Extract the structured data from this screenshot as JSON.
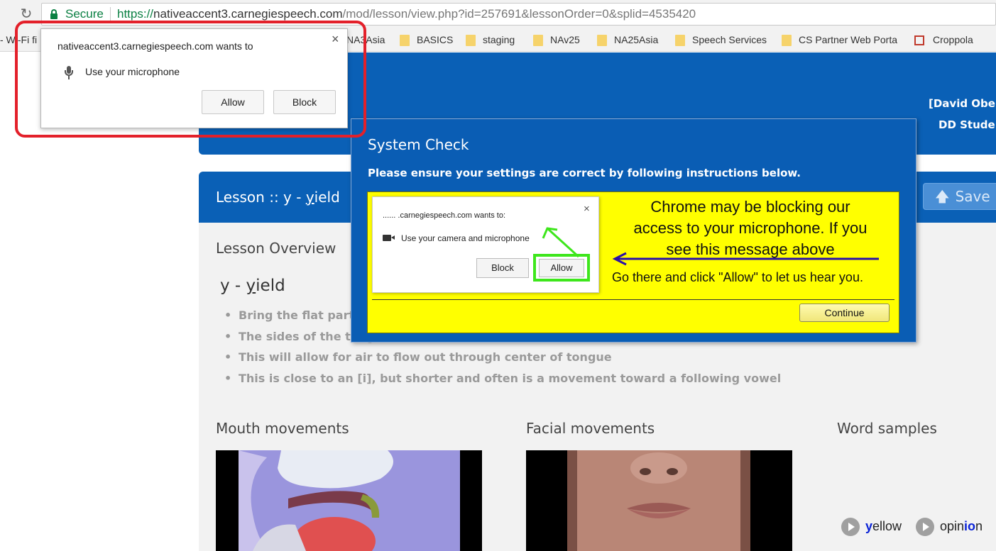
{
  "browser": {
    "secure_label": "Secure",
    "url_proto": "https://",
    "url_host": "nativeaccent3.carnegiespeech.com",
    "url_path": "/mod/lesson/view.php?id=257691&lessonOrder=0&splid=4535420",
    "bookmarks": [
      {
        "label": "- Wi-Fi fi",
        "icon": "none"
      },
      {
        "label": "NA3Asia",
        "icon": "none"
      },
      {
        "label": "BASICS",
        "icon": "folder-icon"
      },
      {
        "label": "staging",
        "icon": "folder-icon"
      },
      {
        "label": "NAv25",
        "icon": "folder-icon"
      },
      {
        "label": "NA25Asia",
        "icon": "folder-icon"
      },
      {
        "label": "Speech Services",
        "icon": "folder-icon"
      },
      {
        "label": "CS Partner Web Porta",
        "icon": "folder-icon"
      },
      {
        "label": "Croppola",
        "icon": "crop-icon"
      }
    ]
  },
  "permission_popup": {
    "title": "nativeaccent3.carnegiespeech.com wants to",
    "request": "Use your microphone",
    "allow_label": "Allow",
    "block_label": "Block",
    "close_glyph": "×"
  },
  "header": {
    "user_name": "[David Oberl",
    "user_role": "DD Student"
  },
  "lesson": {
    "title_prefix": "Lesson :: y - ",
    "title_word_first": "y",
    "title_word_rest": "ield",
    "save_label": "Save",
    "overview_heading": "Lesson Overview",
    "sound_prefix": "y - ",
    "sound_word_first": "y",
    "sound_word_rest": "ield",
    "bullets": [
      "Bring the flat part o",
      "The sides of the tong",
      "This will allow for air to flow out through center of tongue",
      "This is close to an [i], but shorter and often is a movement toward a following vowel"
    ],
    "mouth_heading": "Mouth movements",
    "facial_heading": "Facial movements",
    "words_heading": "Word samples",
    "word_samples": [
      {
        "highlight": "y",
        "rest": "ellow",
        "pre": ""
      },
      {
        "highlight": "io",
        "rest": "n",
        "pre": "opin"
      }
    ]
  },
  "system_check": {
    "title": "System Check",
    "subtitle": "Please ensure your settings are correct by following instructions below.",
    "mini_dialog_title": "...... .carnegiespeech.com wants to:",
    "mini_dialog_request": "Use your camera and microphone",
    "mini_block_label": "Block",
    "mini_allow_label": "Allow",
    "mini_close_glyph": "×",
    "message_lines": [
      "Chrome may be blocking our",
      "access to your microphone. If you",
      "see this message above"
    ],
    "go_message": "Go there and click \"Allow\" to let us hear you.",
    "continue_label": "Continue"
  },
  "colors": {
    "brand_blue": "#0a60b6",
    "highlight_red": "#e3202a",
    "callout_yellow": "#ffff00",
    "allow_green": "#3ee61c",
    "secure_green": "#0b8043"
  }
}
